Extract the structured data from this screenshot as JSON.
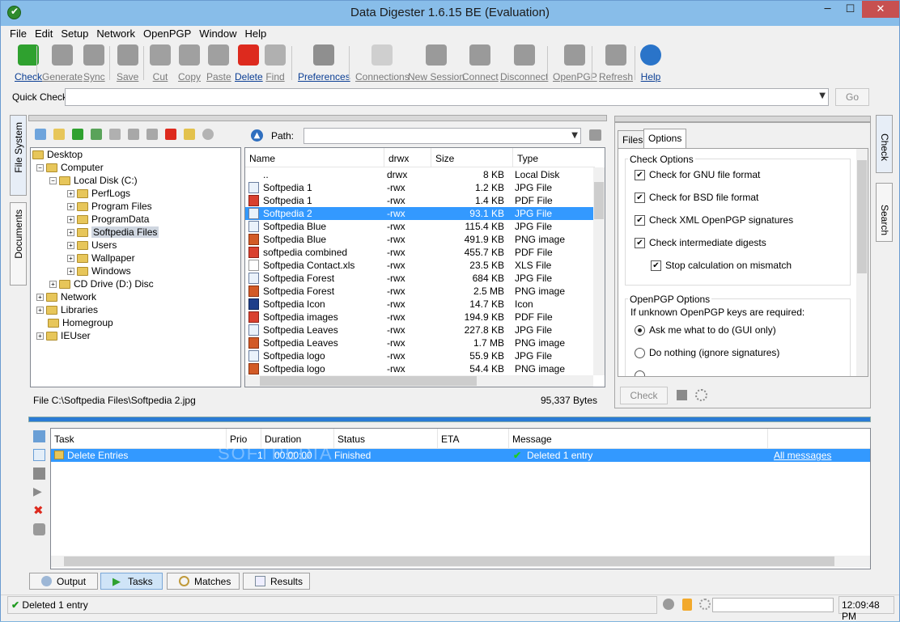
{
  "window": {
    "title": "Data Digester 1.6.15 BE (Evaluation)"
  },
  "menu": [
    "File",
    "Edit",
    "Setup",
    "Network",
    "OpenPGP",
    "Window",
    "Help"
  ],
  "toolbar": [
    {
      "label": "Check",
      "icon": "check-icon",
      "enabled": true
    },
    {
      "label": "Generate",
      "icon": "calculator-icon",
      "enabled": false
    },
    {
      "label": "Sync",
      "icon": "sync-icon",
      "enabled": false
    },
    {
      "label": "Save",
      "icon": "save-icon",
      "enabled": false
    },
    {
      "label": "Cut",
      "icon": "scissors-icon",
      "enabled": false
    },
    {
      "label": "Copy",
      "icon": "copy-icon",
      "enabled": false
    },
    {
      "label": "Paste",
      "icon": "paste-icon",
      "enabled": false
    },
    {
      "label": "Delete",
      "icon": "delete-icon",
      "enabled": true
    },
    {
      "label": "Find",
      "icon": "magnifier-icon",
      "enabled": false
    },
    {
      "label": "Preferences",
      "icon": "wrench-icon",
      "enabled": true
    },
    {
      "label": "Connections",
      "icon": "connections-icon",
      "enabled": false
    },
    {
      "label": "New Session",
      "icon": "monitor-icon",
      "enabled": false
    },
    {
      "label": "Connect",
      "icon": "connect-icon",
      "enabled": false
    },
    {
      "label": "Disconnect",
      "icon": "disconnect-icon",
      "enabled": false
    },
    {
      "label": "OpenPGP",
      "icon": "key-icon",
      "enabled": false
    },
    {
      "label": "Refresh",
      "icon": "refresh-icon",
      "enabled": false
    },
    {
      "label": "Help",
      "icon": "help-icon",
      "enabled": true
    }
  ],
  "quick_check": {
    "label": "Quick Check",
    "value": "",
    "go": "Go"
  },
  "side_tabs_left": [
    "File System",
    "Documents"
  ],
  "side_tabs_right": [
    "Check",
    "Search"
  ],
  "tree": [
    {
      "label": "Desktop",
      "level": 0,
      "expander": ""
    },
    {
      "label": "Computer",
      "level": 1,
      "expander": "−"
    },
    {
      "label": "Local Disk (C:)",
      "level": 2,
      "expander": "−"
    },
    {
      "label": "PerfLogs",
      "level": 3,
      "expander": "+"
    },
    {
      "label": "Program Files",
      "level": 3,
      "expander": "+"
    },
    {
      "label": "ProgramData",
      "level": 3,
      "expander": "+"
    },
    {
      "label": "Softpedia Files",
      "level": 3,
      "expander": "+",
      "selected": true
    },
    {
      "label": "Users",
      "level": 3,
      "expander": "+"
    },
    {
      "label": "Wallpaper",
      "level": 3,
      "expander": "+"
    },
    {
      "label": "Windows",
      "level": 3,
      "expander": "+"
    },
    {
      "label": "CD Drive (D:) Disc",
      "level": 2,
      "expander": "+"
    },
    {
      "label": "Network",
      "level": 0.5,
      "expander": "+"
    },
    {
      "label": "Libraries",
      "level": 0.5,
      "expander": "+"
    },
    {
      "label": "Homegroup",
      "level": 0.5,
      "expander": ""
    },
    {
      "label": "IEUser",
      "level": 0.5,
      "expander": "+"
    }
  ],
  "path": {
    "label": "Path:",
    "value": ""
  },
  "files": {
    "columns": [
      "Name",
      "drwx",
      "Size",
      "Type"
    ],
    "rows": [
      {
        "name": "..",
        "perm": "drwx",
        "size": "8 KB",
        "type": "Local Disk",
        "kind": ""
      },
      {
        "name": "Softpedia 1",
        "perm": "-rwx",
        "size": "1.2 KB",
        "type": "JPG File",
        "kind": "jpg"
      },
      {
        "name": "Softpedia 1",
        "perm": "-rwx",
        "size": "1.4 KB",
        "type": "PDF File",
        "kind": "pdf"
      },
      {
        "name": "Softpedia 2",
        "perm": "-rwx",
        "size": "93.1 KB",
        "type": "JPG File",
        "kind": "jpg",
        "selected": true
      },
      {
        "name": "Softpedia Blue",
        "perm": "-rwx",
        "size": "115.4 KB",
        "type": "JPG File",
        "kind": "jpg"
      },
      {
        "name": "Softpedia Blue",
        "perm": "-rwx",
        "size": "491.9 KB",
        "type": "PNG image",
        "kind": "png"
      },
      {
        "name": "softpedia combined",
        "perm": "-rwx",
        "size": "455.7 KB",
        "type": "PDF File",
        "kind": "pdf"
      },
      {
        "name": "Softpedia Contact.xls",
        "perm": "-rwx",
        "size": "23.5 KB",
        "type": "XLS File",
        "kind": "xls"
      },
      {
        "name": "Softpedia Forest",
        "perm": "-rwx",
        "size": "684 KB",
        "type": "JPG File",
        "kind": "jpg"
      },
      {
        "name": "Softpedia Forest",
        "perm": "-rwx",
        "size": "2.5 MB",
        "type": "PNG image",
        "kind": "png"
      },
      {
        "name": "Softpedia Icon",
        "perm": "-rwx",
        "size": "14.7 KB",
        "type": "Icon",
        "kind": "icon"
      },
      {
        "name": "Softpedia images",
        "perm": "-rwx",
        "size": "194.9 KB",
        "type": "PDF File",
        "kind": "pdf"
      },
      {
        "name": "Softpedia Leaves",
        "perm": "-rwx",
        "size": "227.8 KB",
        "type": "JPG File",
        "kind": "jpg"
      },
      {
        "name": "Softpedia Leaves",
        "perm": "-rwx",
        "size": "1.7 MB",
        "type": "PNG image",
        "kind": "png"
      },
      {
        "name": "Softpedia logo",
        "perm": "-rwx",
        "size": "55.9 KB",
        "type": "JPG File",
        "kind": "jpg"
      },
      {
        "name": "Softpedia logo",
        "perm": "-rwx",
        "size": "54.4 KB",
        "type": "PNG image",
        "kind": "png"
      }
    ]
  },
  "file_status": {
    "path": "File C:\\Softpedia Files\\Softpedia 2.jpg",
    "bytes": "95,337 Bytes"
  },
  "options": {
    "tabs": [
      "Files",
      "Options"
    ],
    "active_tab": "Options",
    "check_group": "Check Options",
    "checks": [
      {
        "label": "Check for GNU file format",
        "checked": true
      },
      {
        "label": "Check for BSD file format",
        "checked": true
      },
      {
        "label": "Check XML OpenPGP signatures",
        "checked": true
      },
      {
        "label": "Check intermediate digests",
        "checked": true
      },
      {
        "label": "Stop calculation on mismatch",
        "checked": true
      }
    ],
    "pgp_group": "OpenPGP Options",
    "pgp_text": "If unknown OpenPGP keys are required:",
    "radios": [
      {
        "label": "Ask me what to do (GUI only)",
        "on": true
      },
      {
        "label": "Do nothing (ignore signatures)",
        "on": false
      }
    ],
    "check_button": "Check"
  },
  "tasks": {
    "columns": [
      "Task",
      "Prio",
      "Duration",
      "Status",
      "ETA",
      "Message"
    ],
    "rows": [
      {
        "task": "Delete Entries",
        "prio": "1",
        "duration": "00:00:00",
        "status": "Finished",
        "eta": "",
        "message": "Deleted 1 entry",
        "link": "All messages"
      }
    ]
  },
  "bottom_tabs": [
    {
      "label": "Output",
      "active": false,
      "icon": "output-icon"
    },
    {
      "label": "Tasks",
      "active": true,
      "icon": "play-icon"
    },
    {
      "label": "Matches",
      "active": false,
      "icon": "magnifier-icon"
    },
    {
      "label": "Results",
      "active": false,
      "icon": "chart-icon"
    }
  ],
  "statusbar": {
    "message": "Deleted 1 entry",
    "time": "12:09:48 PM"
  },
  "watermark": "SOFTPEDIA"
}
